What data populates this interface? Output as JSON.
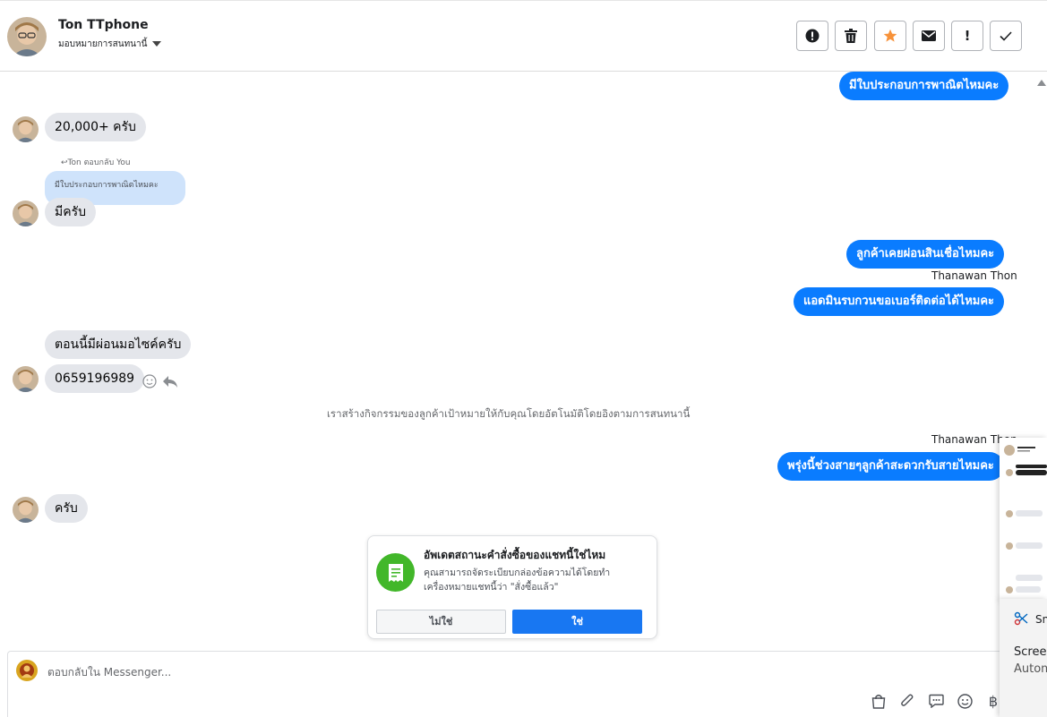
{
  "header": {
    "contact_name": "Ton TTphone",
    "assign_label": "มอบหมายการสนทนานี้",
    "tool_icons": [
      "alert-circle-icon",
      "trash-icon",
      "star-icon",
      "envelope-icon",
      "exclamation-icon",
      "check-icon"
    ],
    "star_color": "#f7923a"
  },
  "messages": {
    "m1_out": "มีใบประกอบการพาณิตไหมคะ",
    "m2_in": "20,000+ ครับ",
    "reply_label": "Ton ตอบกลับ You",
    "reply_quote": "มีใบประกอบการพาณิตไหมคะ",
    "m3_in": "มีครับ",
    "m4_out": "ลูกค้าเคยผ่อนสินเชื่อไหมคะ",
    "sender_1": "Thanawan Thon",
    "m5_out": "แอดมินรบกวนขอเบอร์ติดต่อได้ไหมคะ",
    "m6_in": "ตอนนี้มีผ่อนมอไซค์ครับ",
    "m7_in": "0659196989",
    "system_note": "เราสร้างกิจกรรมของลูกค้าเป้าหมายให้กับคุณโดยอัตโนมัติโดยอิงตามการสนทนานี้",
    "sender_2": "Thanawan Thon",
    "m8_out": "พรุ่งนี้ช่วงสายๆลูกค้าสะดวกรับสายไหมคะ",
    "m9_in": "ครับ"
  },
  "order_card": {
    "title": "อัพเดตสถานะคำสั่งซื้อของแชทนี้ใช่ไหม",
    "body": "คุณสามารถจัดระเบียบกล่องข้อความได้โดยทำเครื่องหมายแชทนี้ว่า \"สั่งซื้อแล้ว\"",
    "no_label": "ไม่ใช่",
    "yes_label": "ใช่",
    "accent": "#1877f2",
    "icon_color": "#42b72a"
  },
  "composer": {
    "placeholder": "ตอบกลับใน Messenger...",
    "tool_icons": [
      "shopping-bag-icon",
      "paperclip-icon",
      "saved-reply-icon",
      "emoji-icon",
      "baht-icon"
    ],
    "baht_symbol": "฿"
  },
  "snip_overlay": {
    "app_name": "Sn",
    "line1": "Screen",
    "line2": "Autom"
  }
}
